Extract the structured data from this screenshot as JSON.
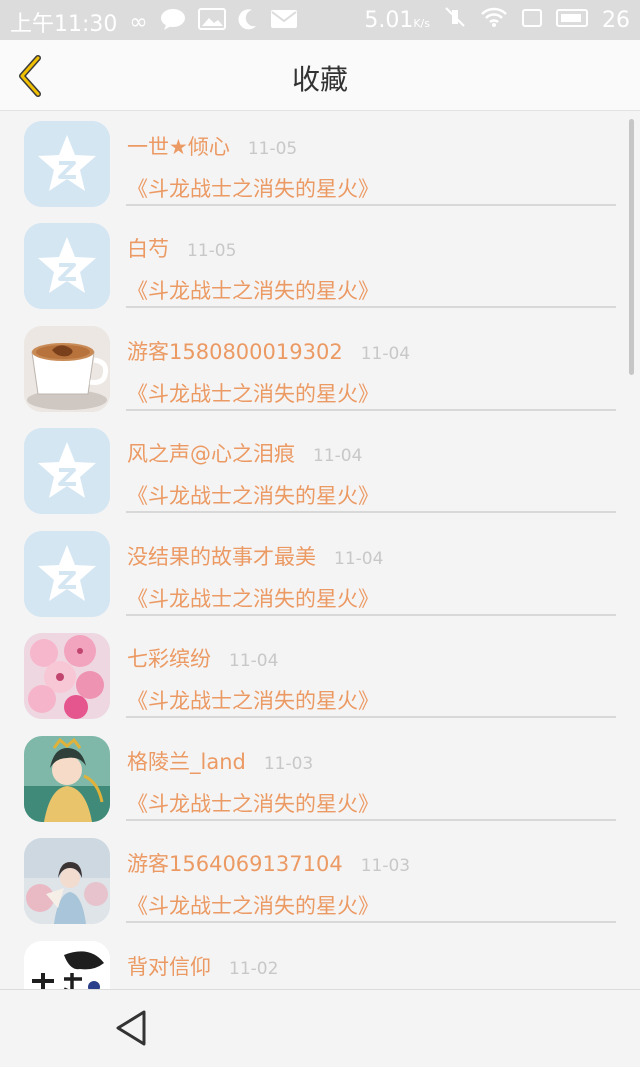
{
  "status_bar": {
    "left": "上午11:30",
    "speed": "5.01",
    "speed_unit": "K/s",
    "battery": "26"
  },
  "header": {
    "title": "收藏",
    "back_icon": "chevron-left-icon"
  },
  "favorites": [
    {
      "user": "一世★倾心",
      "date": "11-05",
      "book": "《斗龙战士之消失的星火》",
      "avatar": "default-star"
    },
    {
      "user": "白芍",
      "date": "11-05",
      "book": "《斗龙战士之消失的星火》",
      "avatar": "default-star"
    },
    {
      "user": "游客1580800019302",
      "date": "11-04",
      "book": "《斗龙战士之消失的星火》",
      "avatar": "coffee-cup"
    },
    {
      "user": "风之声@心之泪痕",
      "date": "11-04",
      "book": "《斗龙战士之消失的星火》",
      "avatar": "default-star"
    },
    {
      "user": "没结果的故事才最美",
      "date": "11-04",
      "book": "《斗龙战士之消失的星火》",
      "avatar": "default-star"
    },
    {
      "user": "七彩缤纷",
      "date": "11-04",
      "book": "《斗龙战士之消失的星火》",
      "avatar": "cherry-blossom"
    },
    {
      "user": "格陵兰_land",
      "date": "11-03",
      "book": "《斗龙战士之消失的星火》",
      "avatar": "anime-girl"
    },
    {
      "user": "游客1564069137104",
      "date": "11-03",
      "book": "《斗龙战士之消失的星火》",
      "avatar": "girl-photo"
    },
    {
      "user": "背对信仰",
      "date": "11-02",
      "book": "",
      "avatar": "calligraphy"
    }
  ],
  "navigation": {
    "back_icon": "triangle-back-icon"
  },
  "colors": {
    "accent": "#ec9a64",
    "date": "#c8c8c8",
    "back_arrow": "#f0c000"
  }
}
